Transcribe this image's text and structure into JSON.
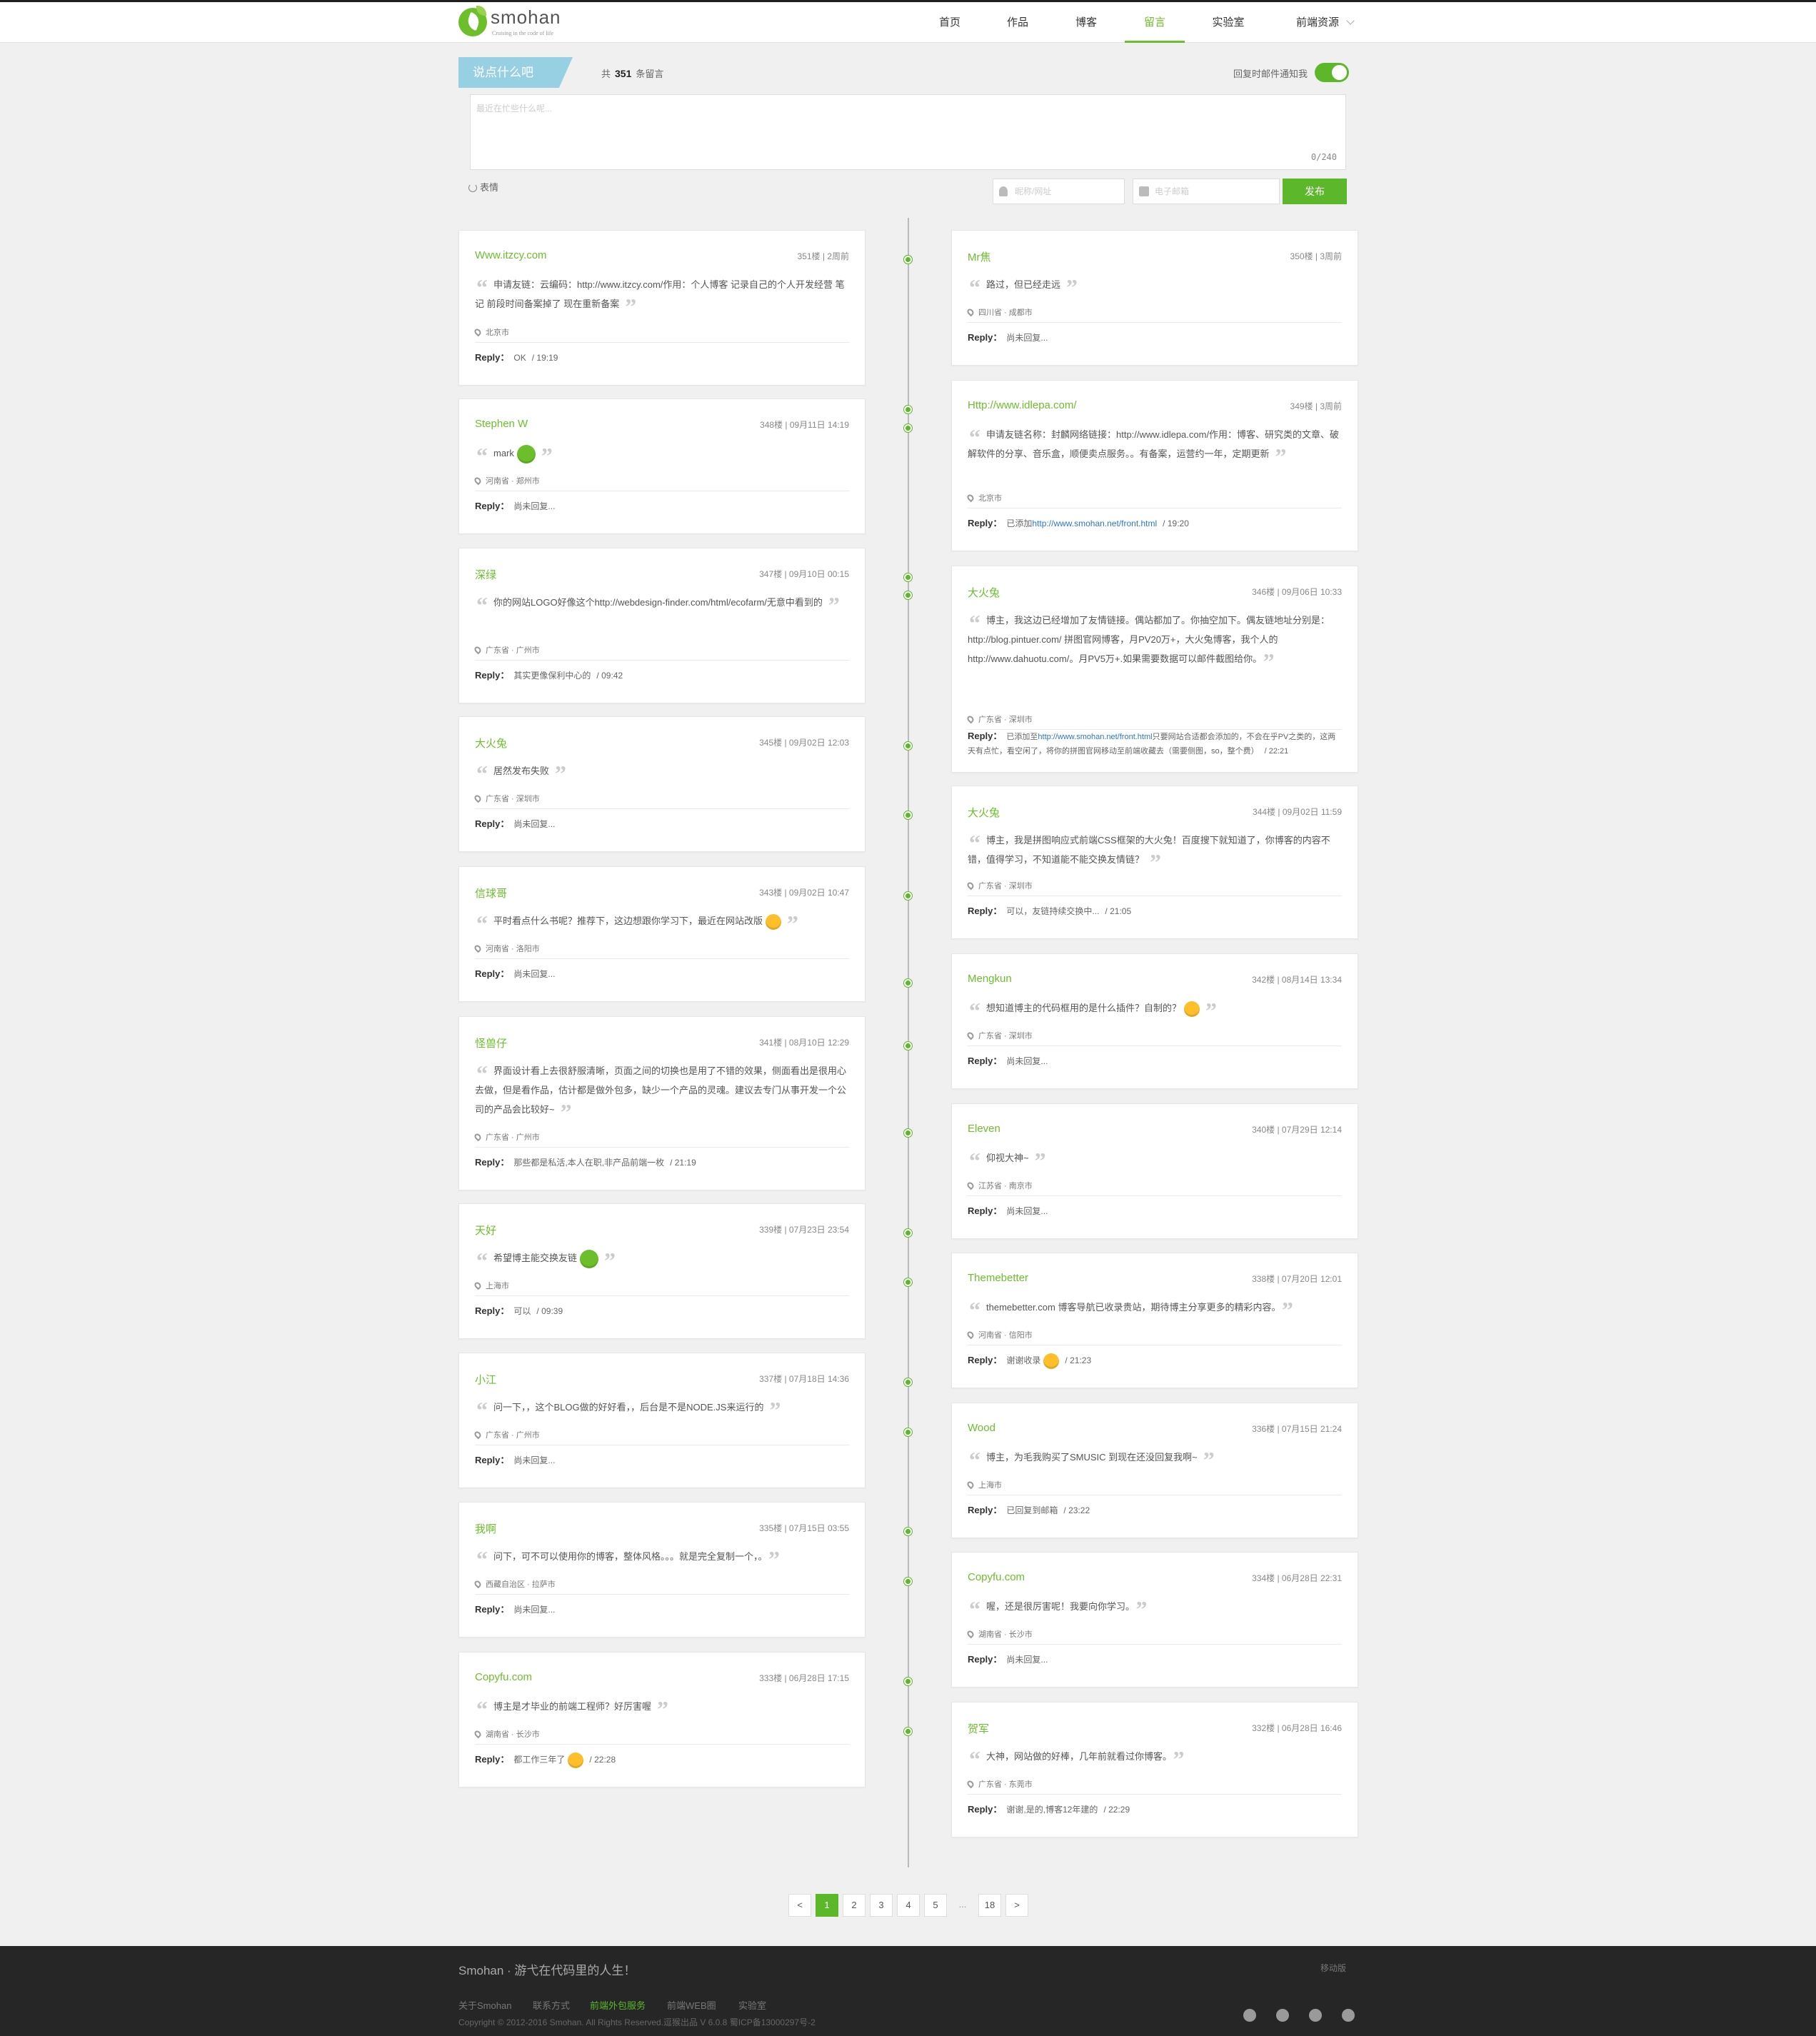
{
  "header": {
    "logo_text": "smohan",
    "logo_tagline": "Cruising in the code of life",
    "nav": [
      {
        "label": "首页",
        "active": false
      },
      {
        "label": "作品",
        "active": false
      },
      {
        "label": "博客",
        "active": false
      },
      {
        "label": "留言",
        "active": true
      },
      {
        "label": "实验室",
        "active": false
      },
      {
        "label": "前端资源",
        "active": false
      }
    ]
  },
  "form": {
    "tag": "说点什么吧",
    "count_prefix": "共",
    "count": "351",
    "count_suffix": "条留言",
    "notify_label": "回复时邮件通知我",
    "notify_on": true,
    "textarea_placeholder": "最近在忙些什么呢...",
    "char_counter": "0/240",
    "emoji_label": "表情",
    "name_placeholder": "昵称/网址",
    "email_placeholder": "电子邮箱",
    "publish_label": "发布"
  },
  "comments_left": [
    {
      "name": "Www.itzcy.com",
      "meta": "351楼 | 2周前",
      "text": "申请友链：云编码：http://www.itzcy.com/作用：个人博客 记录自己的个人开发经营 笔记  前段时间备案掉了 现在重新备案",
      "loc": "北京市",
      "reply_label": "Reply：",
      "reply": "OK",
      "reply_time": "/ 19:19"
    },
    {
      "name": "Stephen W",
      "meta": "348楼 | 09月11日 14:19",
      "text": "mark",
      "emoji": "green",
      "loc": "河南省 · 郑州市",
      "reply_label": "Reply：",
      "reply": "尚未回复..."
    },
    {
      "name": "深绿",
      "meta": "347楼 | 09月10日 00:15",
      "text": "你的网站LOGO好像这个http://webdesign-finder.com/html/ecofarm/无意中看到的",
      "loc": "广东省 · 广州市",
      "reply_label": "Reply：",
      "reply": "其实更像保利中心的",
      "reply_time": "/ 09:42"
    },
    {
      "name": "大火兔",
      "meta": "345楼 | 09月02日 12:03",
      "text": "居然发布失败",
      "loc": "广东省 · 深圳市",
      "reply_label": "Reply：",
      "reply": "尚未回复..."
    },
    {
      "name": "信球哥",
      "meta": "343楼 | 09月02日 10:47",
      "text": "平时看点什么书呢？推荐下，这边想跟你学习下，最近在网站改版",
      "emoji": "yellow",
      "loc": "河南省 · 洛阳市",
      "reply_label": "Reply：",
      "reply": "尚未回复..."
    },
    {
      "name": "怪兽仔",
      "meta": "341楼 | 08月10日 12:29",
      "text": "界面设计看上去很舒服清晰，页面之间的切换也是用了不错的效果，侧面看出是很用心去做，但是看作品，估计都是做外包多，缺少一个产品的灵魂。建议去专门从事开发一个公司的产品会比较好~",
      "loc": "广东省 · 广州市",
      "reply_label": "Reply：",
      "reply": "那些都是私活,本人在职,非产品前端一枚",
      "reply_time": "/ 21:19"
    },
    {
      "name": "天好",
      "meta": "339楼 | 07月23日 23:54",
      "text": "希望博主能交换友链",
      "emoji": "green",
      "loc": "上海市",
      "reply_label": "Reply：",
      "reply": "可以",
      "reply_time": "/ 09:39"
    },
    {
      "name": "小江",
      "meta": "337楼 | 07月18日 14:36",
      "text": "问一下，，这个BLOG做的好好看，，后台是不是NODE.JS来运行的",
      "loc": "广东省 · 广州市",
      "reply_label": "Reply：",
      "reply": "尚未回复..."
    },
    {
      "name": "我啊",
      "meta": "335楼 | 07月15日 03:55",
      "text": "问下，可不可以使用你的博客，整体风格。。。就是完全复制一个，。",
      "loc": "西藏自治区 · 拉萨市",
      "reply_label": "Reply：",
      "reply": "尚未回复..."
    },
    {
      "name": "Copyfu.com",
      "meta": "333楼 | 06月28日 17:15",
      "text": "博主是才毕业的前端工程师？好厉害喔",
      "loc": "湖南省 · 长沙市",
      "reply_label": "Reply：",
      "reply": "都工作三年了",
      "reply_emoji": "yellow",
      "reply_time": "/ 22:28"
    }
  ],
  "comments_right": [
    {
      "name": "Mr焦",
      "meta": "350楼 | 3周前",
      "text": "路过，但已经走远",
      "loc": "四川省 · 成都市",
      "reply_label": "Reply：",
      "reply": "尚未回复..."
    },
    {
      "name": "Http://www.idlepa.com/",
      "meta": "349楼 | 3周前",
      "text": "申请友链名称：封麟网络链接：http://www.idlepa.com/作用：博客、研究类的文章、破解软件的分享、音乐盒，顺便卖点服务。。有备案，运营约一年，定期更新",
      "loc": "北京市",
      "reply_label": "Reply：",
      "reply": "已添加",
      "reply_link": "http://www.smohan.net/front.html",
      "reply_time": "/ 19:20"
    },
    {
      "name": "大火兔",
      "meta": "346楼 | 09月06日 10:33",
      "text": "博主，我这边已经增加了友情链接。偶站都加了。你抽空加下。偶友链地址分别是：http://blog.pintuer.com/ 拼图官网博客，月PV20万+，大火兔博客，我个人的http://www.dahuotu.com/。月PV5万+.如果需要数据可以邮件截图给你。",
      "loc": "广东省 · 深圳市",
      "reply_label": "Reply：",
      "reply": "已添加至",
      "reply_link": "http://www.smohan.net/front.html",
      "reply_more": "只要网站合适都会添加的，不会在乎PV之类的，这两天有点忙，看空闲了，将你的拼图官网移动至前端收藏去（需要侧图，so，整个费）",
      "reply_time": "/ 22:21"
    },
    {
      "name": "大火兔",
      "meta": "344楼 | 09月02日 11:59",
      "text": "博主，我是拼图响应式前端CSS框架的大火兔！百度搜下就知道了，你博客的内容不错，值得学习，不知道能不能交换友情链？",
      "loc": "广东省 · 深圳市",
      "reply_label": "Reply：",
      "reply": "可以，友链持续交换中...",
      "reply_time": "/ 21:05"
    },
    {
      "name": "Mengkun",
      "meta": "342楼 | 08月14日 13:34",
      "text": "想知道博主的代码框用的是什么插件？自制的？",
      "emoji": "yellow",
      "loc": "广东省 · 深圳市",
      "reply_label": "Reply：",
      "reply": "尚未回复..."
    },
    {
      "name": "Eleven",
      "meta": "340楼 | 07月29日 12:14",
      "text": "仰视大神~",
      "loc": "江苏省 · 南京市",
      "reply_label": "Reply：",
      "reply": "尚未回复..."
    },
    {
      "name": "Themebetter",
      "meta": "338楼 | 07月20日 12:01",
      "text": "themebetter.com 博客导航已收录贵站，期待博主分享更多的精彩内容。",
      "loc": "河南省 · 信阳市",
      "reply_label": "Reply：",
      "reply": "谢谢收录",
      "reply_emoji": "yellow",
      "reply_time": "/ 21:23"
    },
    {
      "name": "Wood",
      "meta": "336楼 | 07月15日 21:24",
      "text": "博主，为毛我购买了SMUSIC 到现在还没回复我啊~",
      "loc": "上海市",
      "reply_label": "Reply：",
      "reply": "已回复到邮箱",
      "reply_time": "/ 23:22"
    },
    {
      "name": "Copyfu.com",
      "meta": "334楼 | 06月28日 22:31",
      "text": "喔，还是很厉害呢！我要向你学习。",
      "loc": "湖南省 · 长沙市",
      "reply_label": "Reply：",
      "reply": "尚未回复..."
    },
    {
      "name": "贺军",
      "meta": "332楼 | 06月28日 16:46",
      "text": "大神，网站做的好棒，几年前就看过你博客。",
      "loc": "广东省 · 东莞市",
      "reply_label": "Reply：",
      "reply": "谢谢,是的,博客12年建的",
      "reply_time": "/ 22:29"
    }
  ],
  "pagination": {
    "prev": "<",
    "pages": [
      "1",
      "2",
      "3",
      "4",
      "5"
    ],
    "current": "1",
    "ellipsis": "...",
    "last": "18",
    "next": ">"
  },
  "footer": {
    "title": "Smohan · 游弋在代码里的人生！",
    "mobile": "移动版",
    "links": [
      "关于Smohan",
      "联系方式",
      "前端外包服务",
      "前端WEB圈",
      "实验室"
    ],
    "highlight_link": "前端外包服务",
    "copyright": "Copyright © 2012-2016 Smohan. All Rights Reserved.逗猴出品 V 6.0.8 蜀ICP备13000297号-2",
    "social_icons": [
      "github-icon",
      "weibo-icon",
      "mail-icon",
      "wechat-icon"
    ]
  }
}
